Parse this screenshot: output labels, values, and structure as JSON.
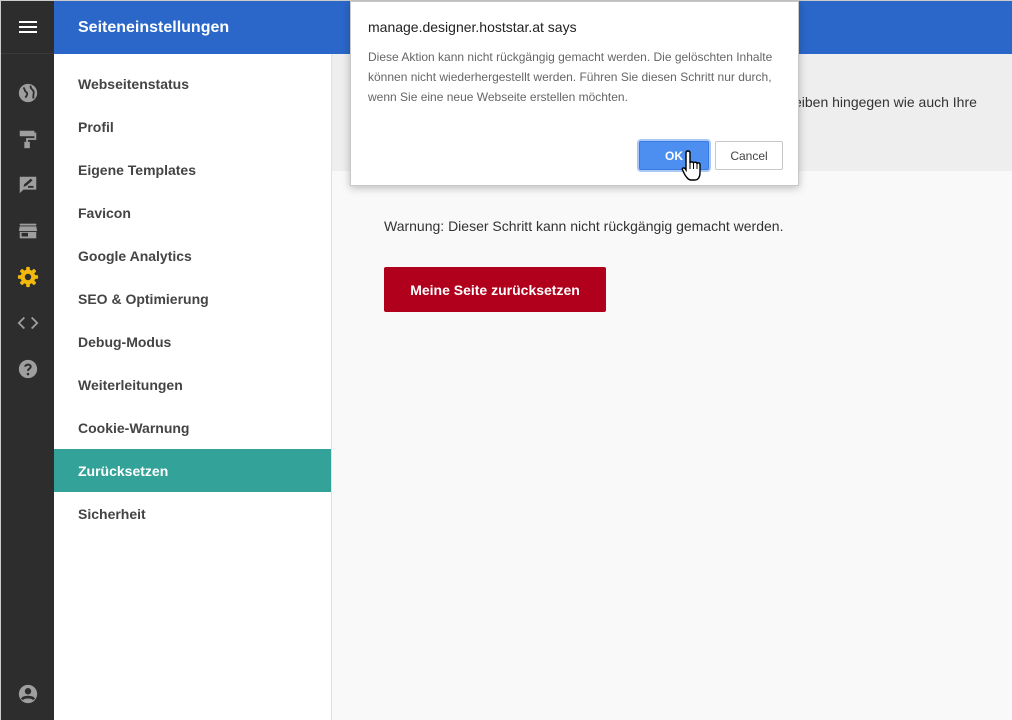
{
  "header": {
    "title": "Seiteneinstellungen"
  },
  "rail": {
    "icons": [
      "menu-icon",
      "globe-icon",
      "paint-roller-icon",
      "edit-note-icon",
      "store-icon",
      "gear-icon",
      "code-icon",
      "help-icon",
      "account-icon"
    ],
    "active_color": "#f2b90c",
    "icon_color": "#9e9e9e"
  },
  "nav": {
    "items": [
      "Webseitenstatus",
      "Profil",
      "Eigene Templates",
      "Favicon",
      "Google Analytics",
      "SEO & Optimierung",
      "Debug-Modus",
      "Weiterleitungen",
      "Cookie-Warnung",
      "Zurücksetzen",
      "Sicherheit"
    ],
    "active": "Zurücksetzen"
  },
  "main": {
    "info_partial": "eiben hingegen wie auch Ihre",
    "warning": "Warnung: Dieser Schritt kann nicht rückgängig gemacht werden.",
    "reset_button": "Meine Seite zurücksetzen"
  },
  "dialog": {
    "title": "manage.designer.hoststar.at says",
    "message": "Diese Aktion kann nicht rückgängig gemacht werden. Die gelöschten Inhalte können nicht wiederhergestellt werden. Führen Sie diesen Schritt nur durch, wenn Sie eine neue Webseite erstellen möchten.",
    "ok": "OK",
    "cancel": "Cancel"
  },
  "colors": {
    "topbar": "#2a67c9",
    "nav_active": "#33a39a",
    "danger": "#b0001c",
    "rail": "#2d2d2d"
  }
}
